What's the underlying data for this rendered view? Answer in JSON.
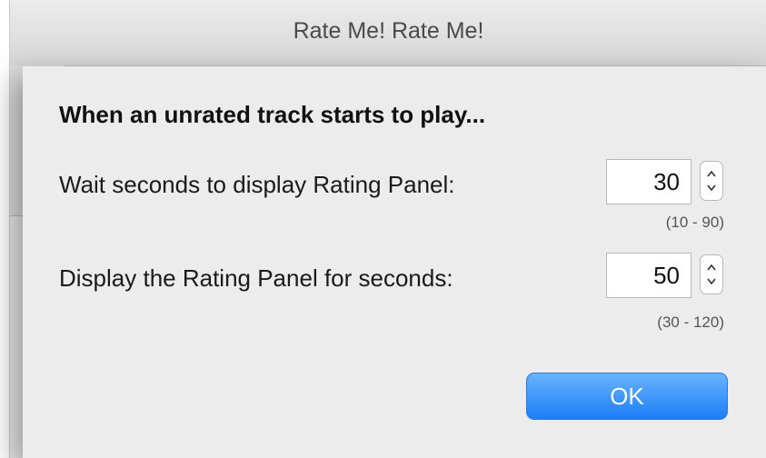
{
  "window": {
    "title": "Rate Me! Rate Me!"
  },
  "dialog": {
    "heading": "When an unrated track starts to play...",
    "wait": {
      "label": "Wait seconds to display Rating Panel:",
      "value": "30",
      "range": "(10 - 90)"
    },
    "display": {
      "label": "Display the Rating Panel for seconds:",
      "value": "50",
      "range": "(30 - 120)"
    },
    "ok_label": "OK"
  }
}
